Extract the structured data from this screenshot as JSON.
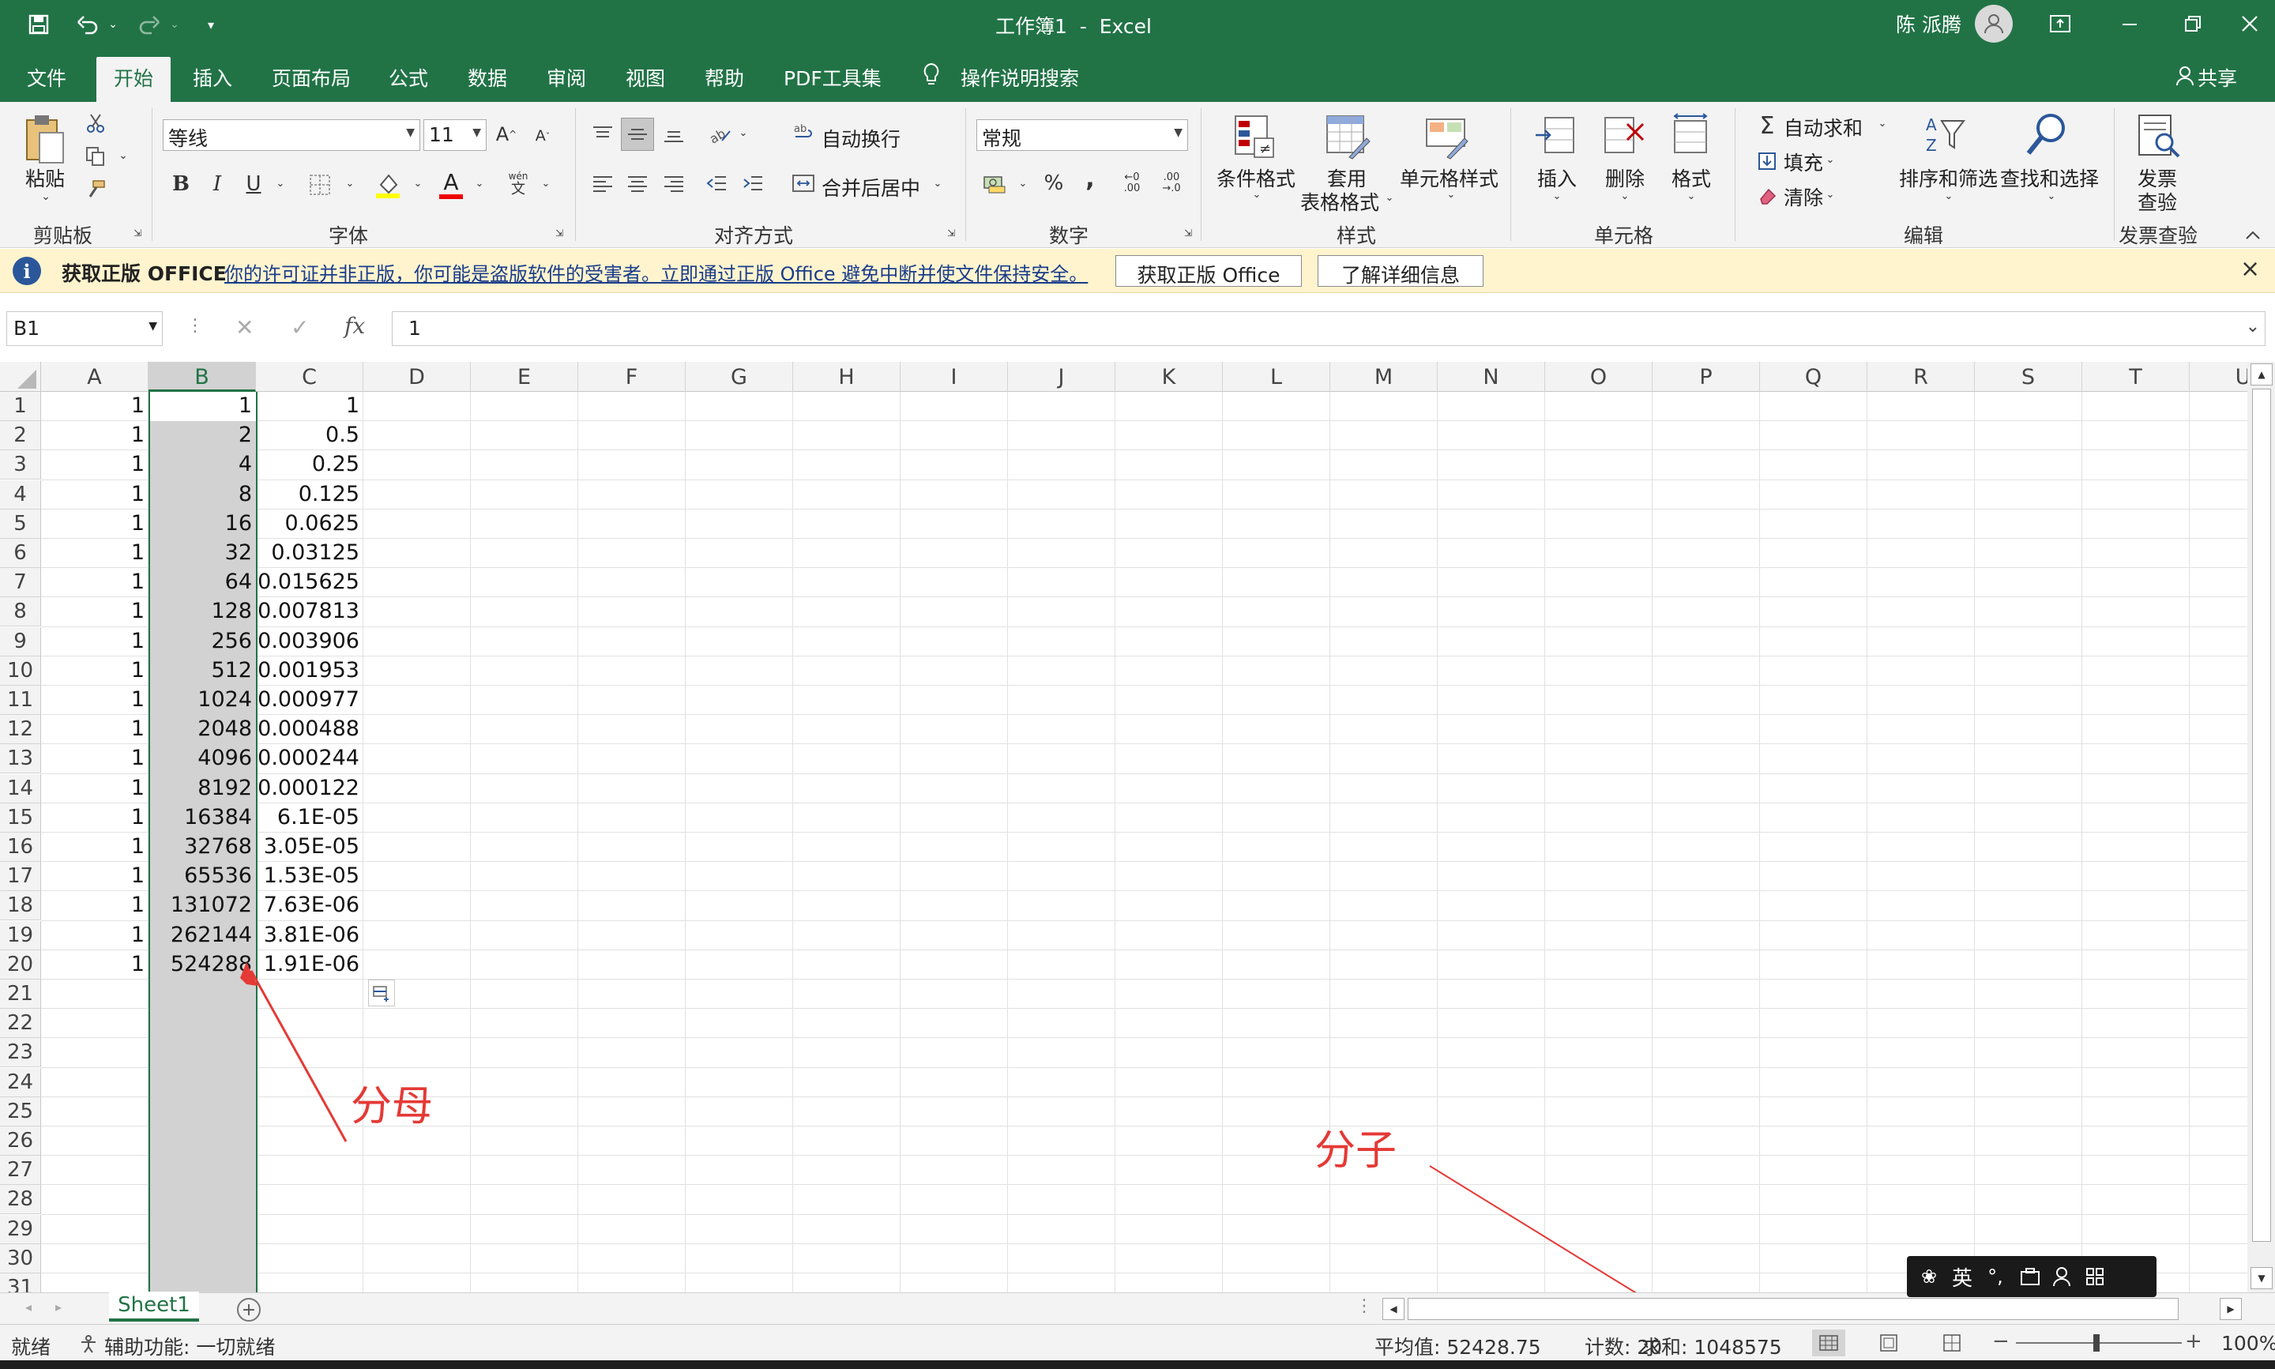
{
  "titlebar": {
    "title": "工作簿1  -  Excel",
    "user": "陈 派腾"
  },
  "tabs": [
    {
      "label": "文件",
      "active": false
    },
    {
      "label": "开始",
      "active": true
    },
    {
      "label": "插入",
      "active": false
    },
    {
      "label": "页面布局",
      "active": false
    },
    {
      "label": "公式",
      "active": false
    },
    {
      "label": "数据",
      "active": false
    },
    {
      "label": "审阅",
      "active": false
    },
    {
      "label": "视图",
      "active": false
    },
    {
      "label": "帮助",
      "active": false
    },
    {
      "label": "PDF工具集",
      "active": false
    },
    {
      "label": "操作说明搜索",
      "active": false
    }
  ],
  "share_label": "共享",
  "ribbon": {
    "clipboard": {
      "paste": "粘贴",
      "group": "剪贴板"
    },
    "font": {
      "name": "等线",
      "size": "11",
      "bold": "B",
      "italic": "I",
      "underline": "U",
      "font_color": "A",
      "phonetic": "wén",
      "group": "字体"
    },
    "align": {
      "wrap": "自动换行",
      "merge": "合并后居中",
      "group": "对齐方式"
    },
    "number": {
      "format": "常规",
      "percent": "%",
      "comma": ",",
      "group": "数字"
    },
    "styles": {
      "cond": "条件格式",
      "table1": "套用",
      "table2": "表格格式",
      "cell": "单元格样式",
      "group": "样式"
    },
    "cells": {
      "insert": "插入",
      "delete": "删除",
      "format": "格式",
      "group": "单元格"
    },
    "edit": {
      "autosum": "自动求和",
      "fill": "填充",
      "clear": "清除",
      "sort": "排序和筛选",
      "find": "查找和选择",
      "group": "编辑"
    },
    "invoice": {
      "btn1": "发票",
      "btn2": "查验",
      "group": "发票查验"
    }
  },
  "msgbar": {
    "title": "获取正版 OFFICE",
    "text": "你的许可证并非正版，你可能是盗版软件的受害者。立即通过正版 Office 避免中断并使文件保持安全。",
    "btn1": "获取正版 Office",
    "btn2": "了解详细信息",
    "close": "×"
  },
  "formula": {
    "namebox": "B1",
    "fx": "fx",
    "cancel": "✕",
    "enter": "✓",
    "value": "1"
  },
  "grid": {
    "columns": [
      "A",
      "B",
      "C",
      "D",
      "E",
      "F",
      "G",
      "H",
      "I",
      "J",
      "K",
      "L",
      "M",
      "N",
      "O",
      "P",
      "Q",
      "R",
      "S",
      "T",
      "U"
    ],
    "row_numbers": [
      "1",
      "2",
      "3",
      "4",
      "5",
      "6",
      "7",
      "8",
      "9",
      "10",
      "11",
      "12",
      "13",
      "14",
      "15",
      "16",
      "17",
      "18",
      "19",
      "20",
      "21",
      "22",
      "23",
      "24",
      "25",
      "26",
      "27",
      "28",
      "29",
      "30",
      "31"
    ],
    "col_a": [
      "1",
      "1",
      "1",
      "1",
      "1",
      "1",
      "1",
      "1",
      "1",
      "1",
      "1",
      "1",
      "1",
      "1",
      "1",
      "1",
      "1",
      "1",
      "1",
      "1"
    ],
    "col_b": [
      "1",
      "2",
      "4",
      "8",
      "16",
      "32",
      "64",
      "128",
      "256",
      "512",
      "1024",
      "2048",
      "4096",
      "8192",
      "16384",
      "32768",
      "65536",
      "131072",
      "262144",
      "524288"
    ],
    "col_c": [
      "1",
      "0.5",
      "0.25",
      "0.125",
      "0.0625",
      "0.03125",
      "0.015625",
      "0.007813",
      "0.003906",
      "0.001953",
      "0.000977",
      "0.000488",
      "0.000244",
      "0.000122",
      "6.1E-05",
      "3.05E-05",
      "1.53E-05",
      "7.63E-06",
      "3.81E-06",
      "1.91E-06"
    ]
  },
  "annotations": {
    "denominator": "分母",
    "numerator": "分子",
    "color": "#e53935"
  },
  "sheet": {
    "name": "Sheet1",
    "add": "+"
  },
  "ime": {
    "lang": "英"
  },
  "status": {
    "ready": "就绪",
    "accessibility": "辅助功能: 一切就绪",
    "average": "平均值: 52428.75",
    "count": "计数: 20",
    "sum": "求和: 1048575",
    "zoom": "100%"
  },
  "colors": {
    "brand": "#217346",
    "warning": "#fff4ce",
    "info": "#2b579a"
  }
}
